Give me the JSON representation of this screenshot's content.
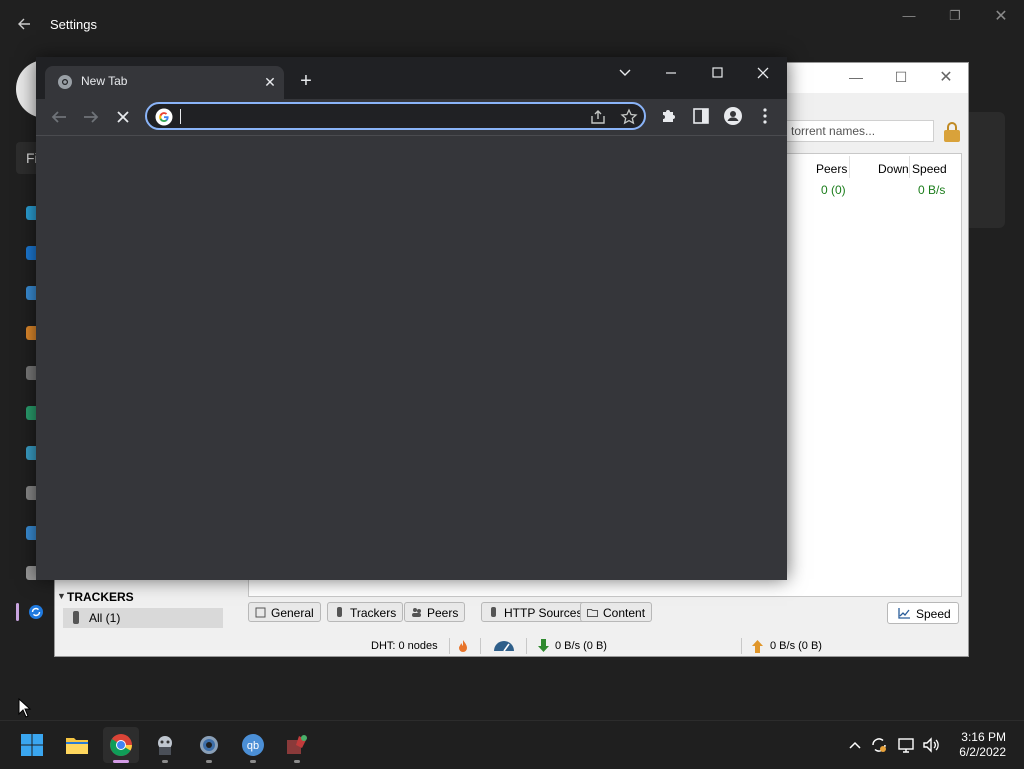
{
  "settings": {
    "title": "Settings",
    "find_placeholder": "Fi"
  },
  "qbittorrent": {
    "search_placeholder": "torrent names...",
    "columns": [
      "Peers",
      "Down Speed"
    ],
    "row": {
      "peers": "0 (0)",
      "down_speed": "0 B/s"
    },
    "sidebar": {
      "trackers_heading": "TRACKERS",
      "all_item": "All (1)"
    },
    "tabs": [
      "General",
      "Trackers",
      "Peers",
      "HTTP Sources",
      "Content"
    ],
    "speed_button": "Speed",
    "status": {
      "dht": "DHT: 0 nodes",
      "download": "0 B/s (0 B)",
      "upload": "0 B/s (0 B)"
    }
  },
  "chrome": {
    "tab_title": "New Tab",
    "address_value": ""
  },
  "taskbar": {
    "apps": [
      "start-icon",
      "file-explorer-icon",
      "chrome-icon",
      "app-icon",
      "settings-gear-icon",
      "qbittorrent-icon",
      "ruby-installer-icon"
    ],
    "time": "3:16 PM",
    "date": "6/2/2022"
  },
  "colors": {
    "chrome_frame": "#202124",
    "chrome_toolbar": "#35363a",
    "omnibox_focus": "#8ab4f8",
    "qbt_value_green": "#1b7d1b",
    "active_indicator": "#d39be6"
  }
}
